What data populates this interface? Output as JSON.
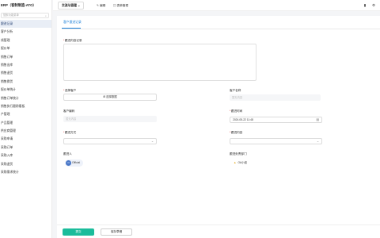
{
  "app": {
    "title": "ERP（客制制造-ATO）"
  },
  "sidebar": {
    "search_placeholder": "搜索功能菜单",
    "items": [
      {
        "label": "跟进记录",
        "active": true
      },
      {
        "label": "客户分析"
      },
      {
        "label": "线管理"
      },
      {
        "label": "报价单"
      },
      {
        "label": "销售订单"
      },
      {
        "label": "销售出库"
      },
      {
        "label": "销售退货"
      },
      {
        "label": "销售换货"
      },
      {
        "label": "报价单统计"
      },
      {
        "label": "销售订单统计"
      },
      {
        "label": "销售执行跟踪看板"
      },
      {
        "label": "产管理"
      },
      {
        "label": "产品管理"
      },
      {
        "label": "供应商管理"
      },
      {
        "label": "采购申请"
      },
      {
        "label": "采购订单"
      },
      {
        "label": "采购入库"
      },
      {
        "label": "采购退货"
      },
      {
        "label": "采购需求统计"
      }
    ]
  },
  "topbar": {
    "module": "交流与管理",
    "module_caret": "⌄",
    "edit_label": "编辑",
    "form_manage_label": "表单管理",
    "right_icons": [
      "document-icon",
      "gear-icon"
    ]
  },
  "form": {
    "tab_label": "客户跟进记录",
    "content_label": "跟进内容记录",
    "select_customer_label": "选择客户",
    "select_data_button": "选择数据",
    "customer_name_label": "客户名称",
    "customer_name_placeholder": "暂无内容",
    "customer_code_label": "客户编码",
    "customer_code_placeholder": "暂无内容",
    "follow_time_label": "跟进时间",
    "follow_time_value": "2024-05-22 11:48",
    "follow_method_label": "跟进方式",
    "follow_content_label": "跟进内容",
    "follower_label": "跟进人",
    "follower_name": "Official",
    "follower_avatar": "O",
    "dept_label": "跟进负责部门",
    "dept_name": "OA小组"
  },
  "footer": {
    "submit_label": "提交",
    "save_draft_label": "保存草稿"
  },
  "colors": {
    "accent": "#1a7fd8",
    "submit": "#1bbc9b",
    "required": "#e53935"
  }
}
